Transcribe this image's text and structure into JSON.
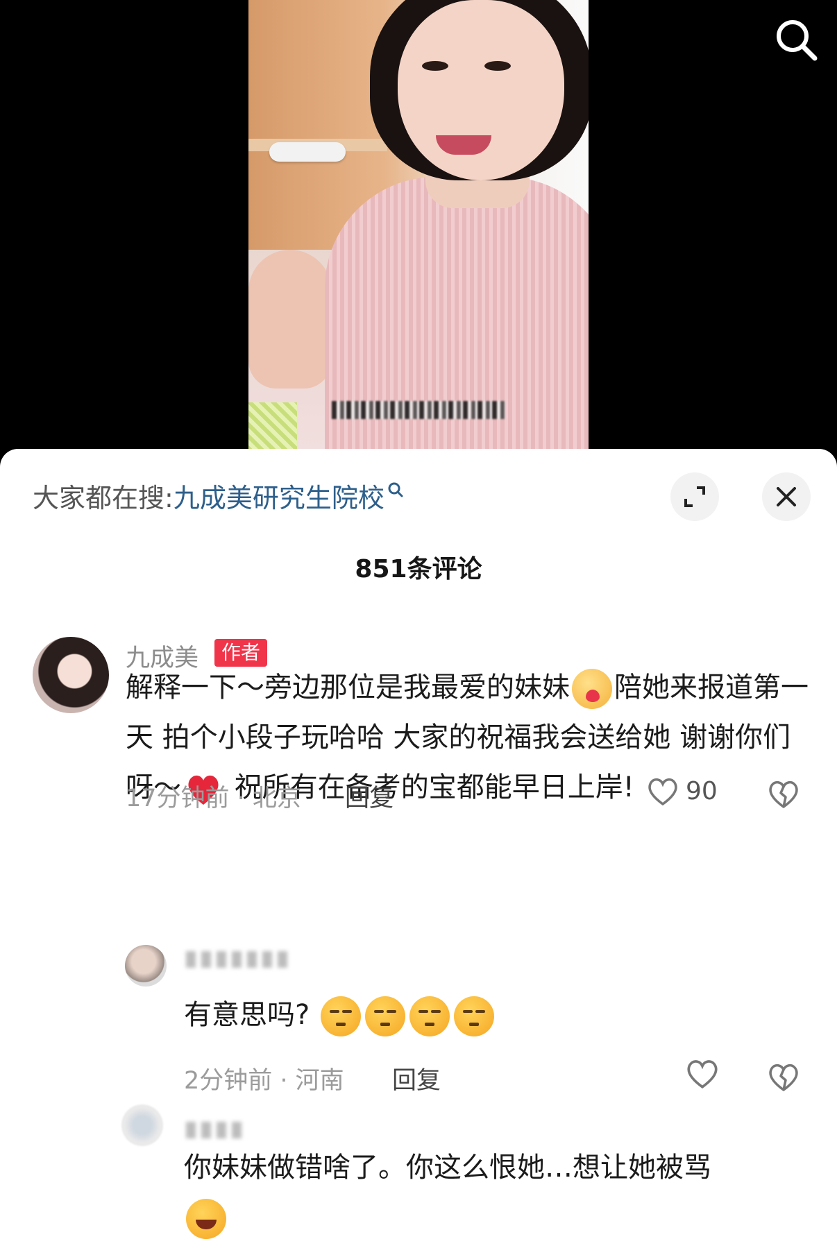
{
  "search_hint": {
    "prefix": "大家都在搜:",
    "term": "九成美研究生院校"
  },
  "comment_count": "851条评论",
  "author_comment": {
    "name": "九成美",
    "badge": "作者",
    "text_part1": "解释一下～旁边那位是我最爱的妹妹",
    "text_part2": "陪她来报道第一天 拍个小段子玩哈哈 大家的祝福我会送给她 谢谢你们呀～",
    "text_part3": " 祝所有在备考的宝都能早日上岸!",
    "meta": "17分钟前 · 北京",
    "reply_label": "回复",
    "like_count": "90"
  },
  "replies": [
    {
      "text": "有意思吗?",
      "meta": "2分钟前 · 河南",
      "reply_label": "回复"
    },
    {
      "text": "你妹妹做错啥了。你这么恨她…想让她被骂"
    }
  ],
  "icons": {
    "top_search": "search-icon",
    "expand": "expand-icon",
    "close": "close-icon",
    "like": "heart-outline-icon",
    "dislike": "broken-heart-icon"
  },
  "colors": {
    "badge": "#f0344a",
    "search_term": "#2d5f8b"
  }
}
